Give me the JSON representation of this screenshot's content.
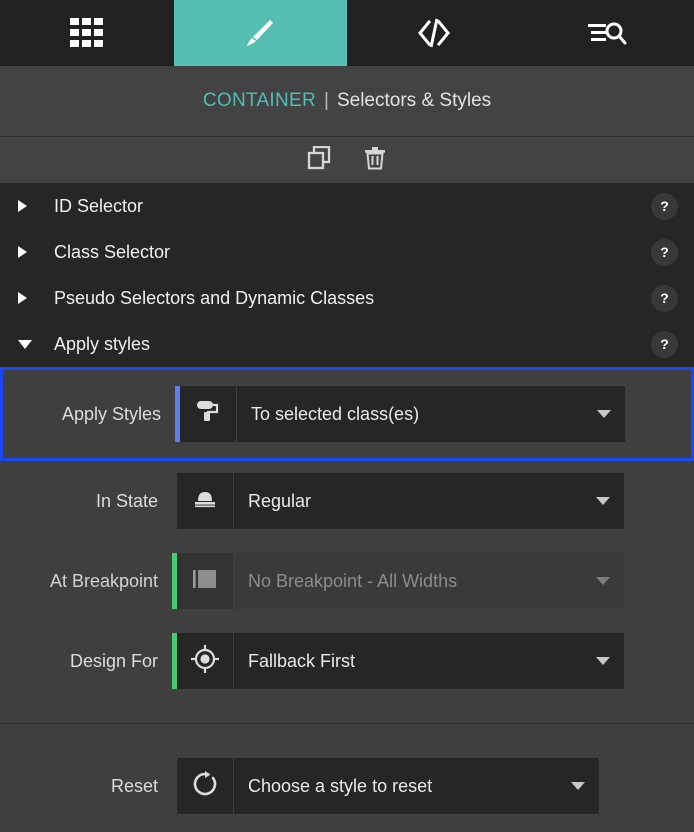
{
  "tabbar": {
    "tabs": [
      {
        "name": "grid-tab",
        "icon": "grid-icon",
        "active": false
      },
      {
        "name": "paint-tab",
        "icon": "paintbrush-icon",
        "active": true
      },
      {
        "name": "code-tab",
        "icon": "code-icon",
        "active": false
      },
      {
        "name": "search-tab",
        "icon": "list-search-icon",
        "active": false
      }
    ],
    "active_color": "#55bfb4"
  },
  "context": {
    "element": "CONTAINER",
    "separator": "|",
    "title": "Selectors & Styles",
    "element_color": "#4ec0b3"
  },
  "actionbar": {
    "duplicate_label": "Duplicate",
    "delete_label": "Delete"
  },
  "accordion": {
    "help_label": "?",
    "items": [
      {
        "label": "ID Selector",
        "expanded": false
      },
      {
        "label": "Class Selector",
        "expanded": false
      },
      {
        "label": "Pseudo Selectors and Dynamic Classes",
        "expanded": false
      },
      {
        "label": "Apply styles",
        "expanded": true
      }
    ]
  },
  "form": {
    "apply_styles": {
      "label": "Apply Styles",
      "value": "To selected class(es)",
      "icon": "paint-roller-icon",
      "accent": "#5b82e8",
      "focused": true,
      "focus_color": "#1c47f5",
      "disabled": false
    },
    "in_state": {
      "label": "In State",
      "value": "Regular",
      "icon": "mouse-hover-icon",
      "accent": "none",
      "focused": false,
      "disabled": false
    },
    "at_breakpoint": {
      "label": "At Breakpoint",
      "value": "No Breakpoint - All Widths",
      "icon": "breakpoint-width-icon",
      "accent": "#4aca72",
      "focused": false,
      "disabled": true
    },
    "design_for": {
      "label": "Design For",
      "value": "Fallback First",
      "icon": "target-crosshair-icon",
      "accent": "#4aca72",
      "focused": false,
      "disabled": false
    },
    "reset": {
      "label": "Reset",
      "value": "Choose a style to reset",
      "icon": "refresh-circle-icon",
      "accent": "none",
      "focused": false,
      "disabled": false
    }
  }
}
